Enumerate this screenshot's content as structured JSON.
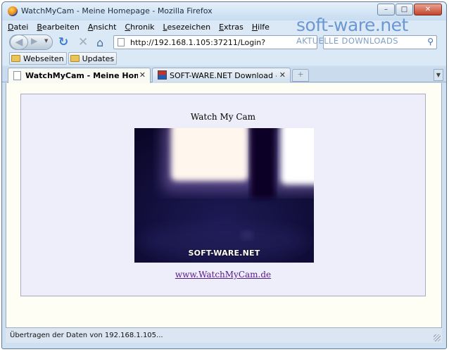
{
  "window": {
    "title": "WatchMyCam - Meine Homepage - Mozilla Firefox",
    "buttons": {
      "minimize": "–",
      "maximize": "□",
      "close": "✕"
    }
  },
  "menubar": {
    "items": [
      {
        "label": "Datei"
      },
      {
        "label": "Bearbeiten"
      },
      {
        "label": "Ansicht"
      },
      {
        "label": "Chronik"
      },
      {
        "label": "Lesezeichen"
      },
      {
        "label": "Extras"
      },
      {
        "label": "Hilfe"
      }
    ]
  },
  "navbar": {
    "back_glyph": "◀",
    "forward_glyph": "▶",
    "dropdown_glyph": "▼",
    "reload_glyph": "↻",
    "stop_glyph": "✕",
    "home_glyph": "⌂",
    "url": "http://192.168.1.105:37211/Login?",
    "search_value": "",
    "search_glyph": "⚲"
  },
  "watermark": {
    "main": "soft-ware.net",
    "sub": "AKTUELLE DOWNLOADS"
  },
  "bookmarks": [
    {
      "label": "Webseiten"
    },
    {
      "label": "Updates"
    }
  ],
  "tabs": [
    {
      "label": "WatchMyCam - Meine Homepage",
      "close": "✕",
      "active": true
    },
    {
      "label": "SOFT-WARE.NET Download - Freew...",
      "close": "✕",
      "active": false
    }
  ],
  "tab_new": "+",
  "tab_list_glyph": "▼",
  "page": {
    "title": "Watch My Cam",
    "image_overlay": "SOFT-WARE.NET",
    "link": "www.WatchMyCam.de"
  },
  "status": {
    "text": "Übertragen der Daten von 192.168.1.105..."
  },
  "colors": {
    "chrome": "#dbe8f5",
    "page_background": "#fefef4",
    "panel_background": "#eeeefa",
    "link": "#551a8b"
  }
}
